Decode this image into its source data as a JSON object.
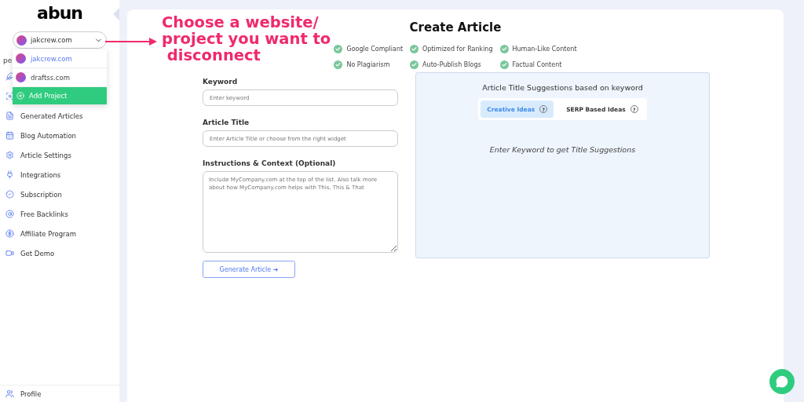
{
  "logo": "abun",
  "project_select": {
    "value": "jakcrew.com",
    "expanded": true,
    "options": [
      {
        "label": "jakcrew.com",
        "selected": true
      },
      {
        "label": "draftss.com",
        "selected": false
      }
    ],
    "add_button": "Add Project"
  },
  "sidebar": {
    "section_label": "pe",
    "items": [
      {
        "kind": "covered"
      },
      {
        "kind": "covered"
      },
      {
        "kind": "link",
        "label": "Generated Articles"
      },
      {
        "kind": "link",
        "label": "Blog Automation"
      },
      {
        "kind": "link",
        "label": "Article Settings"
      },
      {
        "kind": "link",
        "label": "Integrations"
      },
      {
        "kind": "link",
        "label": "Subscription"
      },
      {
        "kind": "link",
        "label": "Free Backlinks"
      },
      {
        "kind": "link",
        "label": "Affiliate Program"
      },
      {
        "kind": "link",
        "label": "Get Demo"
      }
    ],
    "footer": {
      "label": "Profile"
    }
  },
  "annotation": {
    "lines": [
      "Choose a website/",
      "project you want to",
      " disconnect"
    ]
  },
  "page_title": "Create Article",
  "features": [
    "Google Compliant",
    "Optimized for Ranking",
    "Human-Like Content",
    "No Plagiarism",
    "Auto-Publish Blogs",
    "Factual Content"
  ],
  "form": {
    "fields": [
      {
        "kind": "input",
        "label": "Keyword",
        "placeholder": "Enter keyword"
      },
      {
        "kind": "input",
        "label": "Article Title",
        "placeholder": "Enter Article Title or choose from the right widget"
      },
      {
        "kind": "textarea",
        "label": "Instructions & Context (Optional)",
        "placeholder": "Include MyCompany.com at the top of the list. Also talk more about how MyCompany.com helps with This, This & That"
      }
    ],
    "submit": "Generate Article ➜"
  },
  "suggestions": {
    "title": "Article Title Suggestions based on keyword",
    "tabs": [
      {
        "label": "Creative Ideas",
        "selected": true
      },
      {
        "label": "SERP Based Ideas",
        "selected": false
      }
    ],
    "help_mark": "?",
    "empty_text": "Enter Keyword to get Title Suggestions"
  }
}
